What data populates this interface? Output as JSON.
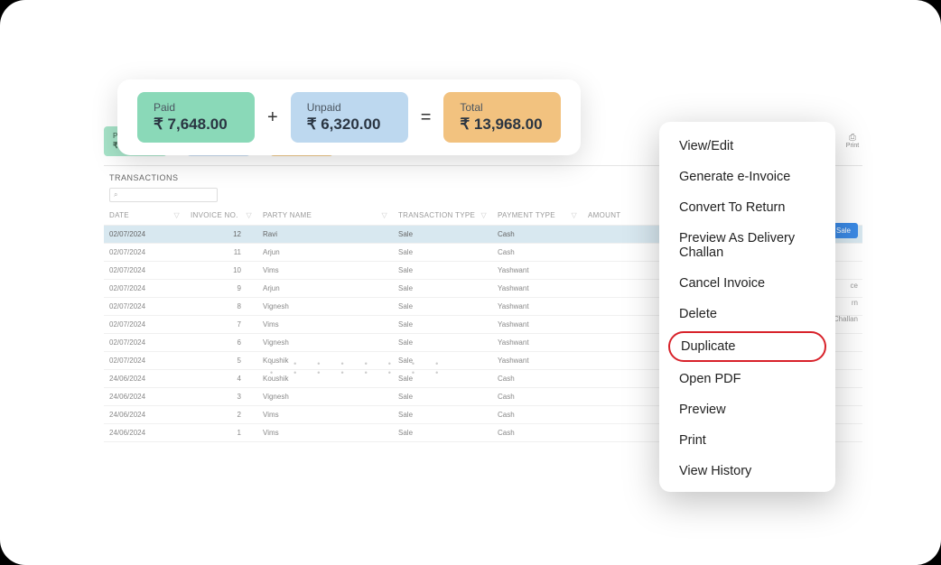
{
  "summary": {
    "paid": {
      "label": "Paid",
      "value": "₹ 7,648.00"
    },
    "unpaid": {
      "label": "Unpaid",
      "value": "₹ 6,320.00"
    },
    "total": {
      "label": "Total",
      "value": "₹ 13,968.00"
    },
    "plus": "+",
    "equals": "="
  },
  "transactions": {
    "title": "TRANSACTIONS",
    "search_glyph": "⌕",
    "columns": {
      "date": "DATE",
      "invoice_no": "INVOICE NO.",
      "party_name": "PARTY NAME",
      "transaction_type": "TRANSACTION TYPE",
      "payment_type": "PAYMENT TYPE",
      "amount": "AMOUNT"
    },
    "rows": [
      {
        "date": "02/07/2024",
        "invno": "12",
        "party": "Ravi",
        "ttype": "Sale",
        "ptype": "Cash"
      },
      {
        "date": "02/07/2024",
        "invno": "11",
        "party": "Arjun",
        "ttype": "Sale",
        "ptype": "Cash"
      },
      {
        "date": "02/07/2024",
        "invno": "10",
        "party": "Vims",
        "ttype": "Sale",
        "ptype": "Yashwant"
      },
      {
        "date": "02/07/2024",
        "invno": "9",
        "party": "Arjun",
        "ttype": "Sale",
        "ptype": "Yashwant"
      },
      {
        "date": "02/07/2024",
        "invno": "8",
        "party": "Vignesh",
        "ttype": "Sale",
        "ptype": "Yashwant"
      },
      {
        "date": "02/07/2024",
        "invno": "7",
        "party": "Vims",
        "ttype": "Sale",
        "ptype": "Yashwant"
      },
      {
        "date": "02/07/2024",
        "invno": "6",
        "party": "Vignesh",
        "ttype": "Sale",
        "ptype": "Yashwant"
      },
      {
        "date": "02/07/2024",
        "invno": "5",
        "party": "Koushik",
        "ttype": "Sale",
        "ptype": "Yashwant"
      },
      {
        "date": "24/06/2024",
        "invno": "4",
        "party": "Koushik",
        "ttype": "Sale",
        "ptype": "Cash"
      },
      {
        "date": "24/06/2024",
        "invno": "3",
        "party": "Vignesh",
        "ttype": "Sale",
        "ptype": "Cash"
      },
      {
        "date": "24/06/2024",
        "invno": "2",
        "party": "Vims",
        "ttype": "Sale",
        "ptype": "Cash"
      },
      {
        "date": "24/06/2024",
        "invno": "1",
        "party": "Vims",
        "ttype": "Sale",
        "ptype": "Cash"
      }
    ]
  },
  "toolbar": {
    "print_label": "Print",
    "add_sale": "Add Sale"
  },
  "rightcol": [
    "ce",
    "rn",
    "very Challan"
  ],
  "context_menu": {
    "items": [
      "View/Edit",
      "Generate e-Invoice",
      "Convert To Return",
      "Preview As Delivery Challan",
      "Cancel Invoice",
      "Delete",
      "Duplicate",
      "Open PDF",
      "Preview",
      "Print",
      "View History"
    ],
    "highlighted": "Duplicate"
  },
  "dots": "•  •  •  •  •  •  •  •\n•  •  •  •  •  •  •  •"
}
